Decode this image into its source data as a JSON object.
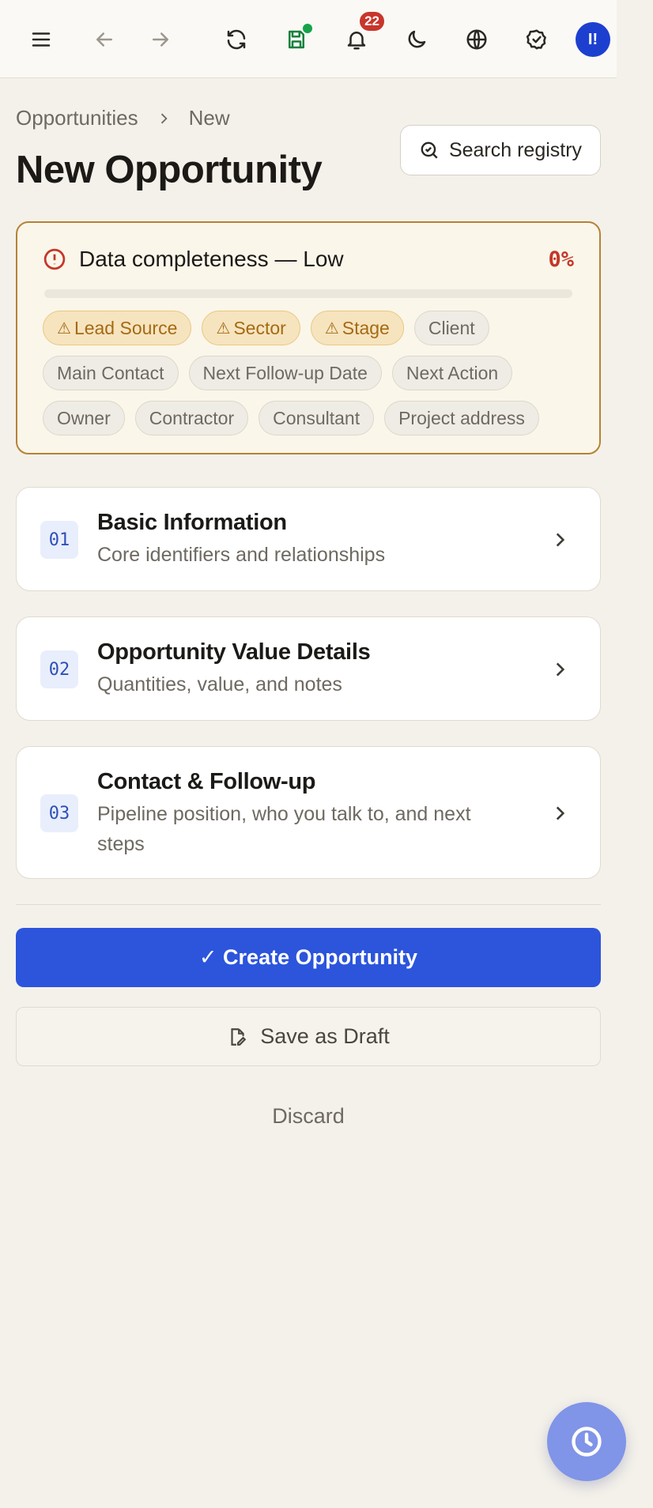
{
  "topbar": {
    "notification_count": "22",
    "avatar_initials": "I!"
  },
  "breadcrumb": {
    "parent": "Opportunities",
    "current": "New"
  },
  "page_title": "New Opportunity",
  "search_registry_label": "Search registry",
  "completeness": {
    "title": "Data completeness — Low",
    "percent_label": "0%",
    "percent": 0,
    "chips": [
      {
        "label": "Lead Source",
        "warn": true
      },
      {
        "label": "Sector",
        "warn": true
      },
      {
        "label": "Stage",
        "warn": true
      },
      {
        "label": "Client",
        "warn": false
      },
      {
        "label": "Main Contact",
        "warn": false
      },
      {
        "label": "Next Follow-up Date",
        "warn": false
      },
      {
        "label": "Next Action",
        "warn": false
      },
      {
        "label": "Owner",
        "warn": false
      },
      {
        "label": "Contractor",
        "warn": false
      },
      {
        "label": "Consultant",
        "warn": false
      },
      {
        "label": "Project address",
        "warn": false
      }
    ]
  },
  "sections": [
    {
      "number": "01",
      "title": "Basic Information",
      "subtitle": "Core identifiers and relationships"
    },
    {
      "number": "02",
      "title": "Opportunity Value Details",
      "subtitle": "Quantities, value, and notes"
    },
    {
      "number": "03",
      "title": "Contact & Follow-up",
      "subtitle": "Pipeline position, who you talk to, and next steps"
    }
  ],
  "actions": {
    "create_label": "✓ Create Opportunity",
    "draft_label": "Save as Draft",
    "discard_label": "Discard"
  },
  "colors": {
    "accent": "#2c55dc",
    "danger": "#c4372b",
    "warning": "#a46a13"
  }
}
